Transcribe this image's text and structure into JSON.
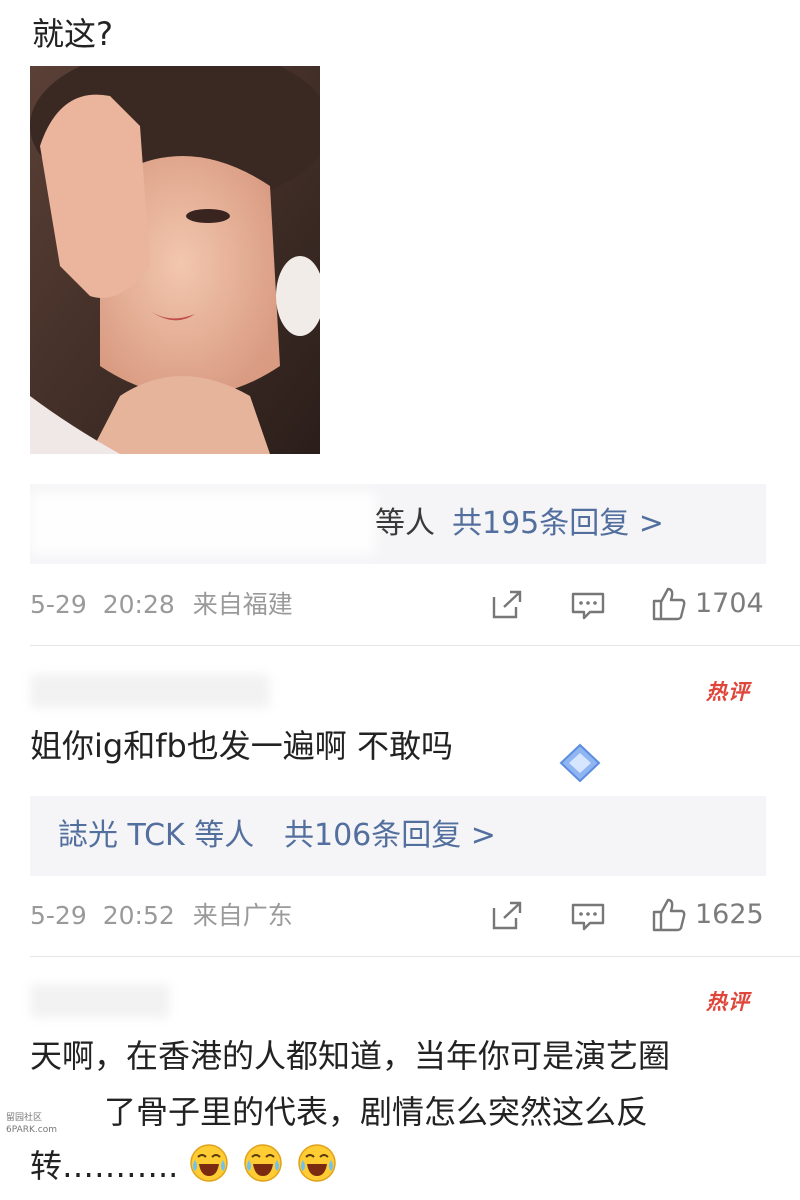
{
  "post": {
    "text": "就这?"
  },
  "thread1": {
    "reply_who": "等人",
    "reply_count": "共195条回复 >",
    "date": "5-29",
    "time": "20:28",
    "location": "来自福建",
    "likes": "1704"
  },
  "comment2": {
    "hot_label": "热评",
    "text": "姐你ig和fb也发一遍啊 不敢吗",
    "reply_who": "誌光 TCK 等人",
    "reply_count": "共106条回复 >",
    "date": "5-29",
    "time": "20:52",
    "location": "来自广东",
    "likes": "1625"
  },
  "comment3": {
    "hot_label": "热评",
    "line1": "天啊，在香港的人都知道，当年你可是演艺圈",
    "line2": "了骨子里的代表，剧情怎么突然这么反",
    "line3": "转………..",
    "emoji": "laughing-crying-emoji"
  },
  "watermark": {
    "line1": "留园社区",
    "line2": "6PARK.com"
  },
  "colors": {
    "link_blue": "#536f9e",
    "hot_red": "#e0453a",
    "meta_gray": "#9a9a9a"
  }
}
